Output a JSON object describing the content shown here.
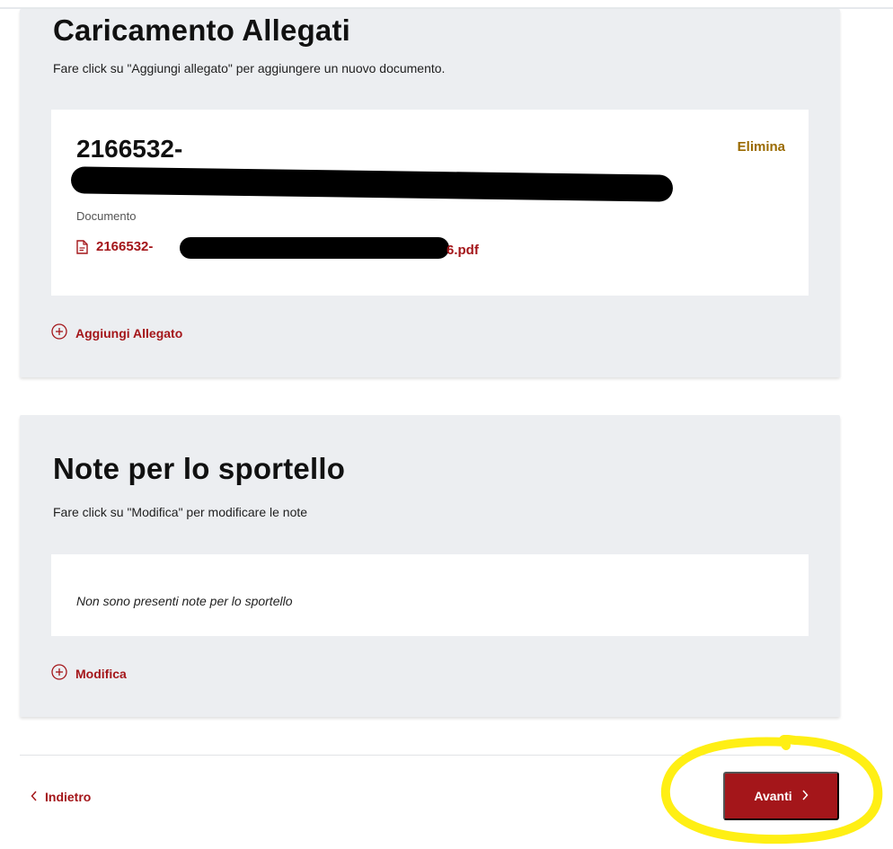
{
  "attachments": {
    "title": "Caricamento Allegati",
    "subtitle": "Fare click su \"Aggiungi allegato\" per aggiungere un nuovo documento.",
    "item": {
      "name_visible": "2166532-",
      "delete_label": "Elimina",
      "doc_label": "Documento",
      "file_prefix": "2166532-",
      "file_suffix": "6.pdf"
    },
    "add_label": "Aggiungi Allegato"
  },
  "notes": {
    "title": "Note per lo sportello",
    "subtitle": "Fare click su \"Modifica\" per modificare le note",
    "empty_text": "Non sono presenti note per lo sportello",
    "edit_label": "Modifica"
  },
  "footer": {
    "back_label": "Indietro",
    "next_label": "Avanti"
  },
  "colors": {
    "accent": "#a4161a",
    "delete": "#9a6a00",
    "card_bg": "#eceef1",
    "highlight": "#ffee00"
  },
  "icons": {
    "file": "file-icon",
    "plus_circle": "plus-circle-icon",
    "chevron_left": "chevron-left-icon",
    "chevron_right": "chevron-right-icon"
  }
}
